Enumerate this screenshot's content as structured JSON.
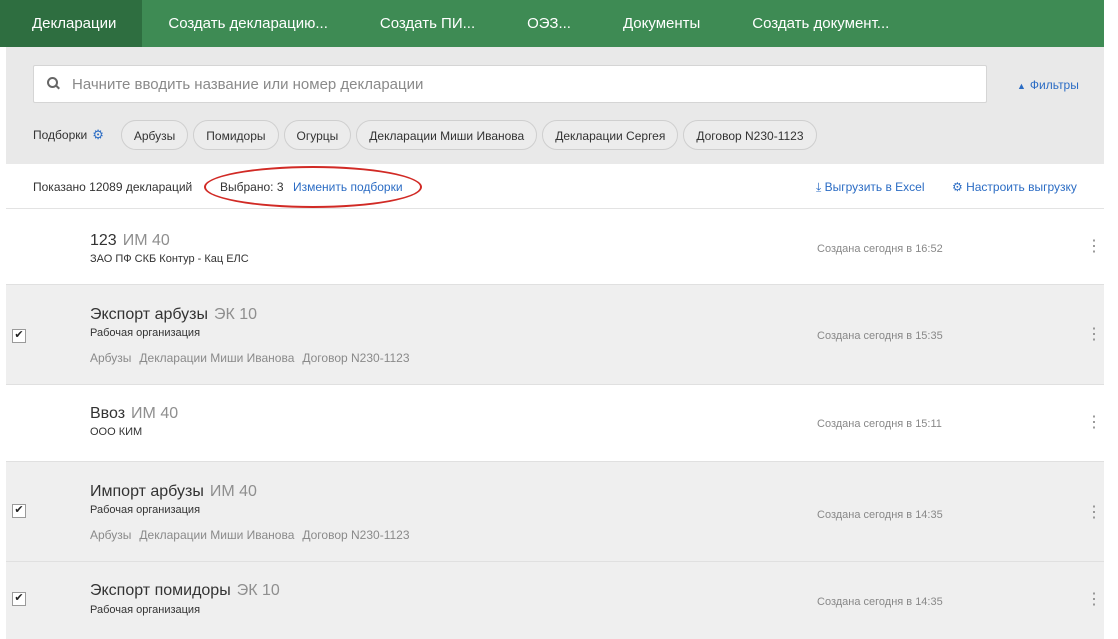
{
  "nav": {
    "tabs": [
      {
        "label": "Декларации",
        "active": true
      },
      {
        "label": "Создать декларацию..."
      },
      {
        "label": "Создать ПИ..."
      },
      {
        "label": "ОЭЗ..."
      },
      {
        "label": "Документы"
      },
      {
        "label": "Создать документ..."
      }
    ]
  },
  "search": {
    "placeholder": "Начните вводить название или номер декларации",
    "value": "",
    "icon": "search-icon"
  },
  "filters": {
    "label": "Фильтры",
    "icon": "sort-arrows-icon"
  },
  "collections": {
    "label": "Подборки",
    "icon": "gear-icon",
    "chips": [
      "Арбузы",
      "Помидоры",
      "Огурцы",
      "Декларации Миши Иванова",
      "Декларации Сергея",
      "Договор N230-1123"
    ]
  },
  "status": {
    "shown": "Показано 12089 деклараций",
    "selected": "Выбрано: 3",
    "change_collections": "Изменить подборки",
    "export_excel": "Выгрузить в Excel",
    "export_icon": "download-icon",
    "setup_export": "Настроить выгрузку",
    "setup_icon": "gear-icon",
    "highlight_color": "#d12a25"
  },
  "rows": [
    {
      "name": "123",
      "code": "ИМ 40",
      "org": "ЗАО ПФ СКБ Контур - Кац ЕЛС",
      "tags": [],
      "created": "Создана сегодня в 16:52",
      "selected": false
    },
    {
      "name": "Экспорт арбузы",
      "code": "ЭК 10",
      "org": "Рабочая организация",
      "tags": [
        "Арбузы",
        "Декларации Миши Иванова",
        "Договор N230-1123"
      ],
      "created": "Создана сегодня в 15:35",
      "selected": true
    },
    {
      "name": "Ввоз",
      "code": "ИМ 40",
      "org": "ООО КИМ",
      "tags": [],
      "created": "Создана сегодня в 15:11",
      "selected": false
    },
    {
      "name": "Импорт арбузы",
      "code": "ИМ 40",
      "org": "Рабочая организация",
      "tags": [
        "Арбузы",
        "Декларации Миши Иванова",
        "Договор N230-1123"
      ],
      "created": "Создана сегодня в 14:35",
      "selected": true
    },
    {
      "name": "Экспорт помидоры",
      "code": "ЭК 10",
      "org": "Рабочая организация",
      "tags": [],
      "created": "Создана сегодня в 14:35",
      "selected": true
    }
  ],
  "colors": {
    "nav_bg": "#3e8b54",
    "nav_active": "#2e6e40",
    "link": "#2b6cc4",
    "panel_bg": "#e9e9e9"
  }
}
